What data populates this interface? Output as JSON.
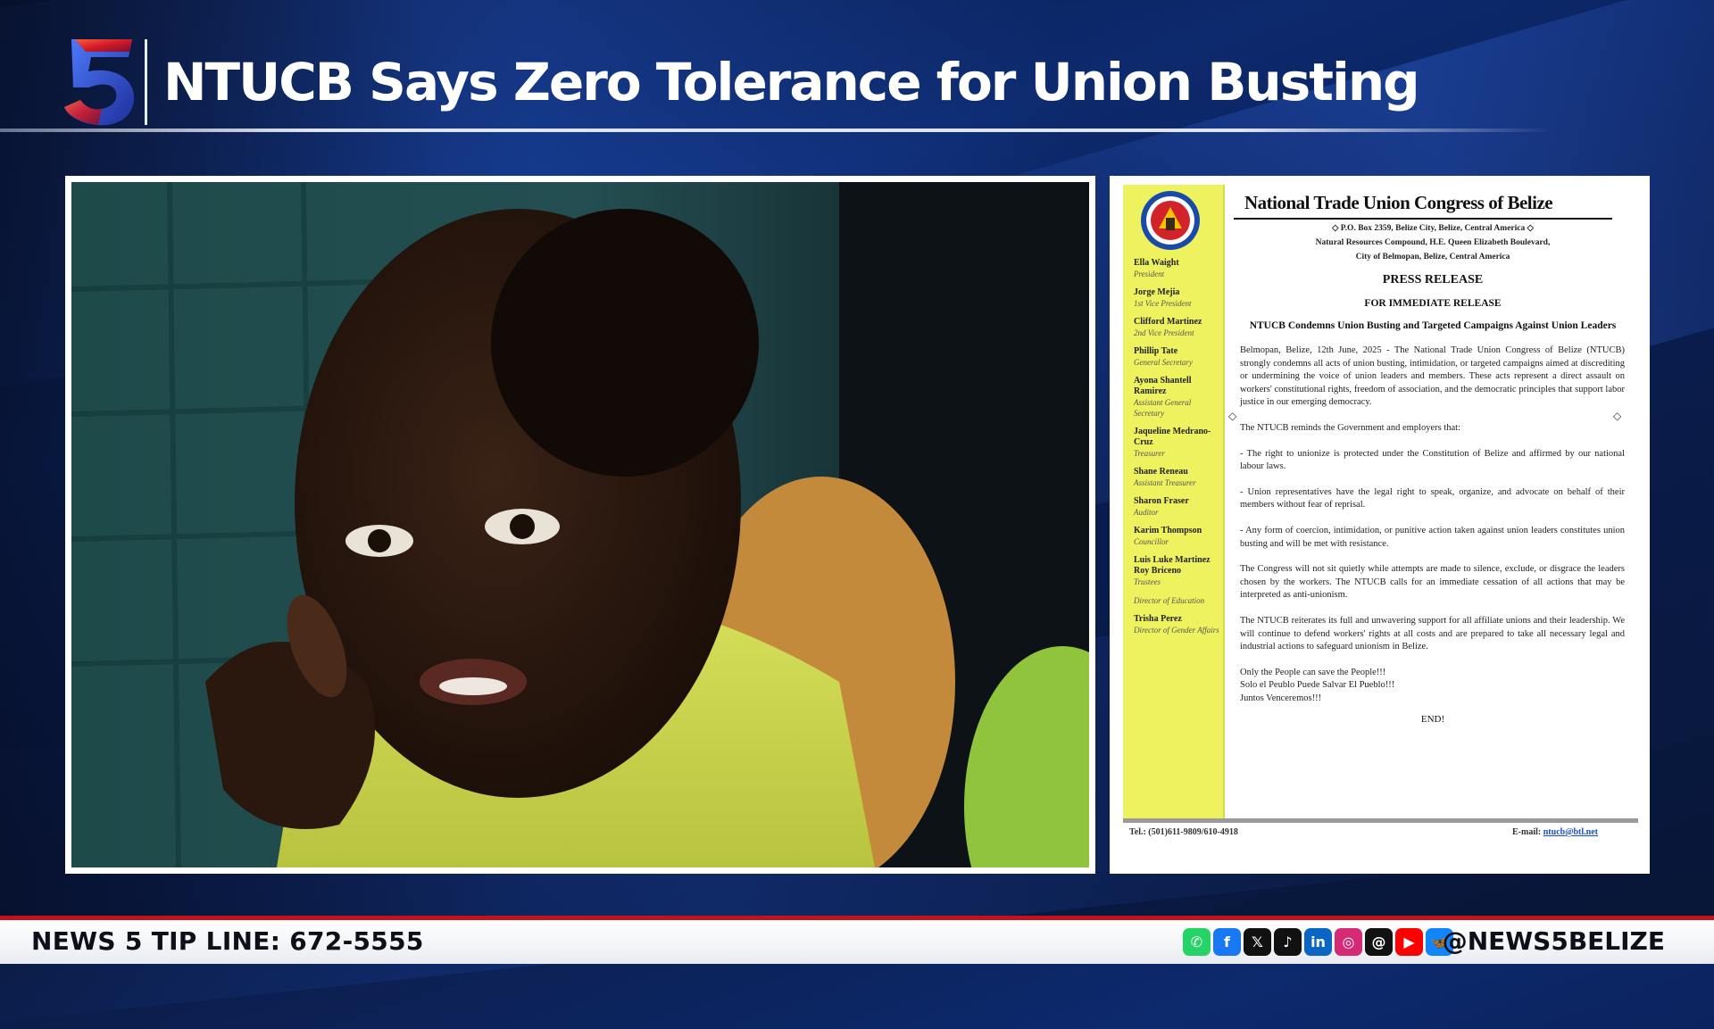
{
  "broadcast": {
    "channel_logo": "5",
    "headline": "NTUCB Says Zero Tolerance for Union Busting"
  },
  "ticker": {
    "tip_line": "NEWS 5 TIP LINE: 672-5555",
    "handle": "@NEWS5BELIZE",
    "social_icons": [
      "whatsapp-icon",
      "facebook-icon",
      "x-icon",
      "tiktok-icon",
      "linkedin-icon",
      "instagram-icon",
      "threads-icon",
      "youtube-icon",
      "bluesky-icon"
    ],
    "social_glyphs": [
      "✆",
      "f",
      "𝕏",
      "♪",
      "in",
      "◎",
      "@",
      "▶",
      "🦋"
    ]
  },
  "document": {
    "org_name": "National Trade Union Congress of Belize",
    "address_1": "◇ P.O. Box 2359, Belize City, Belize, Central America ◇",
    "address_2": "Natural Resources Compound, H.E. Queen Elizabeth Boulevard,",
    "address_3": "City of Belmopan, Belize, Central America",
    "title": "PRESS RELEASE",
    "subtitle": "FOR IMMEDIATE RELEASE",
    "heading": "NTUCB Condemns Union Busting and Targeted Campaigns Against Union Leaders",
    "paragraphs": [
      "Belmopan, Belize, 12th June, 2025 - The National Trade Union Congress of Belize (NTUCB) strongly condemns all acts of union busting, intimidation, or targeted campaigns aimed at discrediting or undermining the voice of union leaders and members. These acts represent a direct assault on workers' constitutional rights, freedom of association, and the democratic principles that support labor justice in our emerging democracy.",
      "The NTUCB reminds the Government and employers that:",
      "- The right to unionize is protected under the Constitution of Belize and affirmed by our national labour laws.",
      "- Union representatives have the legal right to speak, organize, and advocate on behalf of their members without fear of reprisal.",
      "- Any form of coercion, intimidation, or punitive action taken against union leaders constitutes union busting and will be met with resistance.",
      "The Congress will not sit quietly while attempts are made to silence, exclude, or disgrace the leaders chosen by the workers. The NTUCB calls for an immediate cessation of all actions that may be interpreted as anti-unionism.",
      "The NTUCB reiterates its full and unwavering support for all affiliate unions and their leadership. We will continue to defend workers' rights at all costs and are prepared to take all necessary legal and industrial actions to safeguard unionism in Belize."
    ],
    "closing_1": "Only the People can save the People!!!",
    "closing_2": "Solo el Peublo Puede Salvar El Pueblo!!!",
    "closing_3": "Juntos Venceremos!!!",
    "end": "END!",
    "tel": "Tel.: (501)611-9809/610-4918",
    "email_label": "E-mail:",
    "email": "ntucb@btl.net",
    "officers": [
      {
        "name": "Ella Waight",
        "title": "President"
      },
      {
        "name": "Jorge Mejia",
        "title": "1st Vice President"
      },
      {
        "name": "Clifford Martinez",
        "title": "2nd Vice President"
      },
      {
        "name": "Phillip Tate",
        "title": "General Secretary"
      },
      {
        "name": "Ayona Shantell Ramirez",
        "title": "Assistant General Secretary"
      },
      {
        "name": "Jaqueline Medrano-Cruz",
        "title": "Treasurer"
      },
      {
        "name": "Shane Reneau",
        "title": "Assistant Treasurer"
      },
      {
        "name": "Sharon Fraser",
        "title": "Auditor"
      },
      {
        "name": "Karim Thompson",
        "title": "Councillor"
      },
      {
        "name": "Luis Luke Martinez Roy Briceno",
        "title": "Trustees"
      },
      {
        "name": "",
        "title": "Director of Education"
      },
      {
        "name": "Trisha Perez",
        "title": "Director of Gender Affairs"
      }
    ]
  },
  "colors": {
    "ticker_red": "#c4121b",
    "sidebar_yellow": "#eef25f",
    "link_blue": "#1a4fd1"
  }
}
